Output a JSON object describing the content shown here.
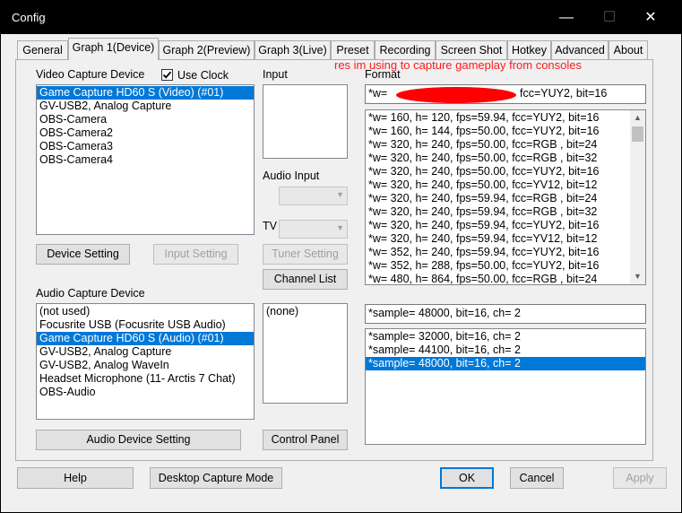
{
  "window": {
    "title": "Config",
    "minimize": "—",
    "maximize": "☐",
    "close": "✕"
  },
  "tabs": [
    "General",
    "Graph 1(Device)",
    "Graph 2(Preview)",
    "Graph 3(Live)",
    "Preset",
    "Recording",
    "Screen Shot",
    "Hotkey",
    "Advanced",
    "About"
  ],
  "active_tab": "Graph 1(Device)",
  "annotation": "res im using to capture gameplay from consoles",
  "video": {
    "label": "Video Capture Device",
    "use_clock_label": "Use Clock",
    "use_clock_checked": true,
    "devices": [
      "Game Capture HD60 S (Video) (#01)",
      "GV-USB2, Analog Capture",
      "OBS-Camera",
      "OBS-Camera2",
      "OBS-Camera3",
      "OBS-Camera4"
    ],
    "selected_index": 0,
    "device_setting": "Device Setting",
    "input_setting": "Input Setting"
  },
  "input": {
    "label": "Input",
    "audio_input_label": "Audio Input",
    "tv_label": "TV",
    "tuner_setting": "Tuner Setting",
    "channel_list": "Channel List"
  },
  "format": {
    "label": "Format",
    "current_prefix": "*w=",
    "current_suffix": "fcc=YUY2, bit=16",
    "items": [
      "*w= 160, h= 120, fps=59.94,  fcc=YUY2, bit=16",
      "*w= 160, h= 144, fps=50.00,  fcc=YUY2, bit=16",
      "*w= 320, h= 240, fps=50.00,  fcc=RGB , bit=24",
      "*w= 320, h= 240, fps=50.00,  fcc=RGB , bit=32",
      "*w= 320, h= 240, fps=50.00,  fcc=YUY2, bit=16",
      "*w= 320, h= 240, fps=50.00,  fcc=YV12, bit=12",
      "*w= 320, h= 240, fps=59.94,  fcc=RGB , bit=24",
      "*w= 320, h= 240, fps=59.94,  fcc=RGB , bit=32",
      "*w= 320, h= 240, fps=59.94,  fcc=YUY2, bit=16",
      "*w= 320, h= 240, fps=59.94,  fcc=YV12, bit=12",
      "*w= 352, h= 240, fps=59.94,  fcc=YUY2, bit=16",
      "*w= 352, h= 288, fps=50.00,  fcc=YUY2, bit=16",
      "*w= 480, h= 864, fps=50.00,  fcc=RGB , bit=24"
    ]
  },
  "audio": {
    "label": "Audio Capture Device",
    "devices": [
      "(not used)",
      "Focusrite USB (Focusrite USB Audio)",
      "Game Capture HD60 S (Audio) (#01)",
      "GV-USB2, Analog Capture",
      "GV-USB2, Analog WaveIn",
      "Headset Microphone (11- Arctis 7 Chat)",
      "OBS-Audio"
    ],
    "selected_index": 2,
    "device_setting": "Audio Device Setting",
    "pin_items": [
      "(none)"
    ],
    "control_panel": "Control Panel",
    "current_format": "*sample= 48000, bit=16, ch= 2",
    "formats": [
      "*sample= 32000, bit=16, ch= 2",
      "*sample= 44100, bit=16, ch= 2",
      "*sample= 48000, bit=16, ch= 2"
    ],
    "selected_format_index": 2
  },
  "footer": {
    "help": "Help",
    "desktop_capture": "Desktop Capture Mode",
    "ok": "OK",
    "cancel": "Cancel",
    "apply": "Apply"
  },
  "colors": {
    "selection": "#0078d7",
    "annotation": "#ff1a1a",
    "redaction": "#ff0000"
  },
  "icons": {
    "checkbox": "check-icon",
    "scroll_up": "chevron-up-icon",
    "scroll_down": "chevron-down-icon",
    "combo": "chevron-down-icon"
  }
}
